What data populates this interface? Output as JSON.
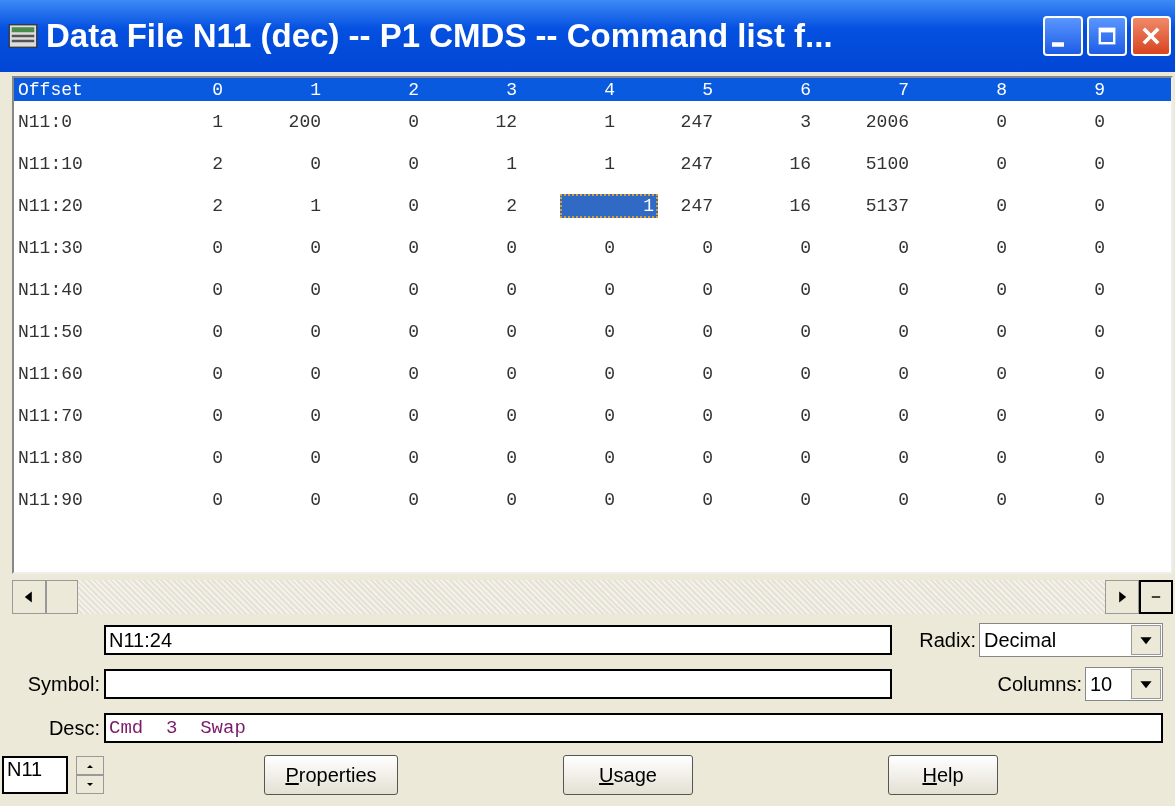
{
  "window": {
    "title": "Data File N11 (dec)  --  P1 CMDS  --  Command list f..."
  },
  "table": {
    "columns": [
      "Offset",
      "0",
      "1",
      "2",
      "3",
      "4",
      "5",
      "6",
      "7",
      "8",
      "9"
    ],
    "rows": [
      {
        "cells": [
          {
            "value": "N11:0",
            "selected": false
          },
          {
            "value": "1",
            "selected": false
          },
          {
            "value": "200",
            "selected": false
          },
          {
            "value": "0",
            "selected": false
          },
          {
            "value": "12",
            "selected": false
          },
          {
            "value": "1",
            "selected": false
          },
          {
            "value": "247",
            "selected": false
          },
          {
            "value": "3",
            "selected": false
          },
          {
            "value": "2006",
            "selected": false
          },
          {
            "value": "0",
            "selected": false
          },
          {
            "value": "0",
            "selected": false
          }
        ]
      },
      {
        "cells": [
          {
            "value": "N11:10",
            "selected": false
          },
          {
            "value": "2",
            "selected": false
          },
          {
            "value": "0",
            "selected": false
          },
          {
            "value": "0",
            "selected": false
          },
          {
            "value": "1",
            "selected": false
          },
          {
            "value": "1",
            "selected": false
          },
          {
            "value": "247",
            "selected": false
          },
          {
            "value": "16",
            "selected": false
          },
          {
            "value": "5100",
            "selected": false
          },
          {
            "value": "0",
            "selected": false
          },
          {
            "value": "0",
            "selected": false
          }
        ]
      },
      {
        "cells": [
          {
            "value": "N11:20",
            "selected": false
          },
          {
            "value": "2",
            "selected": false
          },
          {
            "value": "1",
            "selected": false
          },
          {
            "value": "0",
            "selected": false
          },
          {
            "value": "2",
            "selected": false
          },
          {
            "value": "1",
            "selected": true
          },
          {
            "value": "247",
            "selected": false
          },
          {
            "value": "16",
            "selected": false
          },
          {
            "value": "5137",
            "selected": false
          },
          {
            "value": "0",
            "selected": false
          },
          {
            "value": "0",
            "selected": false
          }
        ]
      },
      {
        "cells": [
          {
            "value": "N11:30",
            "selected": false
          },
          {
            "value": "0",
            "selected": false
          },
          {
            "value": "0",
            "selected": false
          },
          {
            "value": "0",
            "selected": false
          },
          {
            "value": "0",
            "selected": false
          },
          {
            "value": "0",
            "selected": false
          },
          {
            "value": "0",
            "selected": false
          },
          {
            "value": "0",
            "selected": false
          },
          {
            "value": "0",
            "selected": false
          },
          {
            "value": "0",
            "selected": false
          },
          {
            "value": "0",
            "selected": false
          }
        ]
      },
      {
        "cells": [
          {
            "value": "N11:40",
            "selected": false
          },
          {
            "value": "0",
            "selected": false
          },
          {
            "value": "0",
            "selected": false
          },
          {
            "value": "0",
            "selected": false
          },
          {
            "value": "0",
            "selected": false
          },
          {
            "value": "0",
            "selected": false
          },
          {
            "value": "0",
            "selected": false
          },
          {
            "value": "0",
            "selected": false
          },
          {
            "value": "0",
            "selected": false
          },
          {
            "value": "0",
            "selected": false
          },
          {
            "value": "0",
            "selected": false
          }
        ]
      },
      {
        "cells": [
          {
            "value": "N11:50",
            "selected": false
          },
          {
            "value": "0",
            "selected": false
          },
          {
            "value": "0",
            "selected": false
          },
          {
            "value": "0",
            "selected": false
          },
          {
            "value": "0",
            "selected": false
          },
          {
            "value": "0",
            "selected": false
          },
          {
            "value": "0",
            "selected": false
          },
          {
            "value": "0",
            "selected": false
          },
          {
            "value": "0",
            "selected": false
          },
          {
            "value": "0",
            "selected": false
          },
          {
            "value": "0",
            "selected": false
          }
        ]
      },
      {
        "cells": [
          {
            "value": "N11:60",
            "selected": false
          },
          {
            "value": "0",
            "selected": false
          },
          {
            "value": "0",
            "selected": false
          },
          {
            "value": "0",
            "selected": false
          },
          {
            "value": "0",
            "selected": false
          },
          {
            "value": "0",
            "selected": false
          },
          {
            "value": "0",
            "selected": false
          },
          {
            "value": "0",
            "selected": false
          },
          {
            "value": "0",
            "selected": false
          },
          {
            "value": "0",
            "selected": false
          },
          {
            "value": "0",
            "selected": false
          }
        ]
      },
      {
        "cells": [
          {
            "value": "N11:70",
            "selected": false
          },
          {
            "value": "0",
            "selected": false
          },
          {
            "value": "0",
            "selected": false
          },
          {
            "value": "0",
            "selected": false
          },
          {
            "value": "0",
            "selected": false
          },
          {
            "value": "0",
            "selected": false
          },
          {
            "value": "0",
            "selected": false
          },
          {
            "value": "0",
            "selected": false
          },
          {
            "value": "0",
            "selected": false
          },
          {
            "value": "0",
            "selected": false
          },
          {
            "value": "0",
            "selected": false
          }
        ]
      },
      {
        "cells": [
          {
            "value": "N11:80",
            "selected": false
          },
          {
            "value": "0",
            "selected": false
          },
          {
            "value": "0",
            "selected": false
          },
          {
            "value": "0",
            "selected": false
          },
          {
            "value": "0",
            "selected": false
          },
          {
            "value": "0",
            "selected": false
          },
          {
            "value": "0",
            "selected": false
          },
          {
            "value": "0",
            "selected": false
          },
          {
            "value": "0",
            "selected": false
          },
          {
            "value": "0",
            "selected": false
          },
          {
            "value": "0",
            "selected": false
          }
        ]
      },
      {
        "cells": [
          {
            "value": "N11:90",
            "selected": false
          },
          {
            "value": "0",
            "selected": false
          },
          {
            "value": "0",
            "selected": false
          },
          {
            "value": "0",
            "selected": false
          },
          {
            "value": "0",
            "selected": false
          },
          {
            "value": "0",
            "selected": false
          },
          {
            "value": "0",
            "selected": false
          },
          {
            "value": "0",
            "selected": false
          },
          {
            "value": "0",
            "selected": false
          },
          {
            "value": "0",
            "selected": false
          },
          {
            "value": "0",
            "selected": false
          }
        ]
      }
    ]
  },
  "address": {
    "value": "N11:24"
  },
  "radix": {
    "label": "Radix:",
    "value": "Decimal"
  },
  "symbol": {
    "label": "Symbol:"
  },
  "columns_select": {
    "label": "Columns:",
    "value": "10"
  },
  "desc": {
    "label": "Desc:",
    "value": "Cmd  3  Swap"
  },
  "file_spinner": {
    "value": "N11"
  },
  "buttons": [
    "Properties",
    "Usage",
    "Help"
  ]
}
